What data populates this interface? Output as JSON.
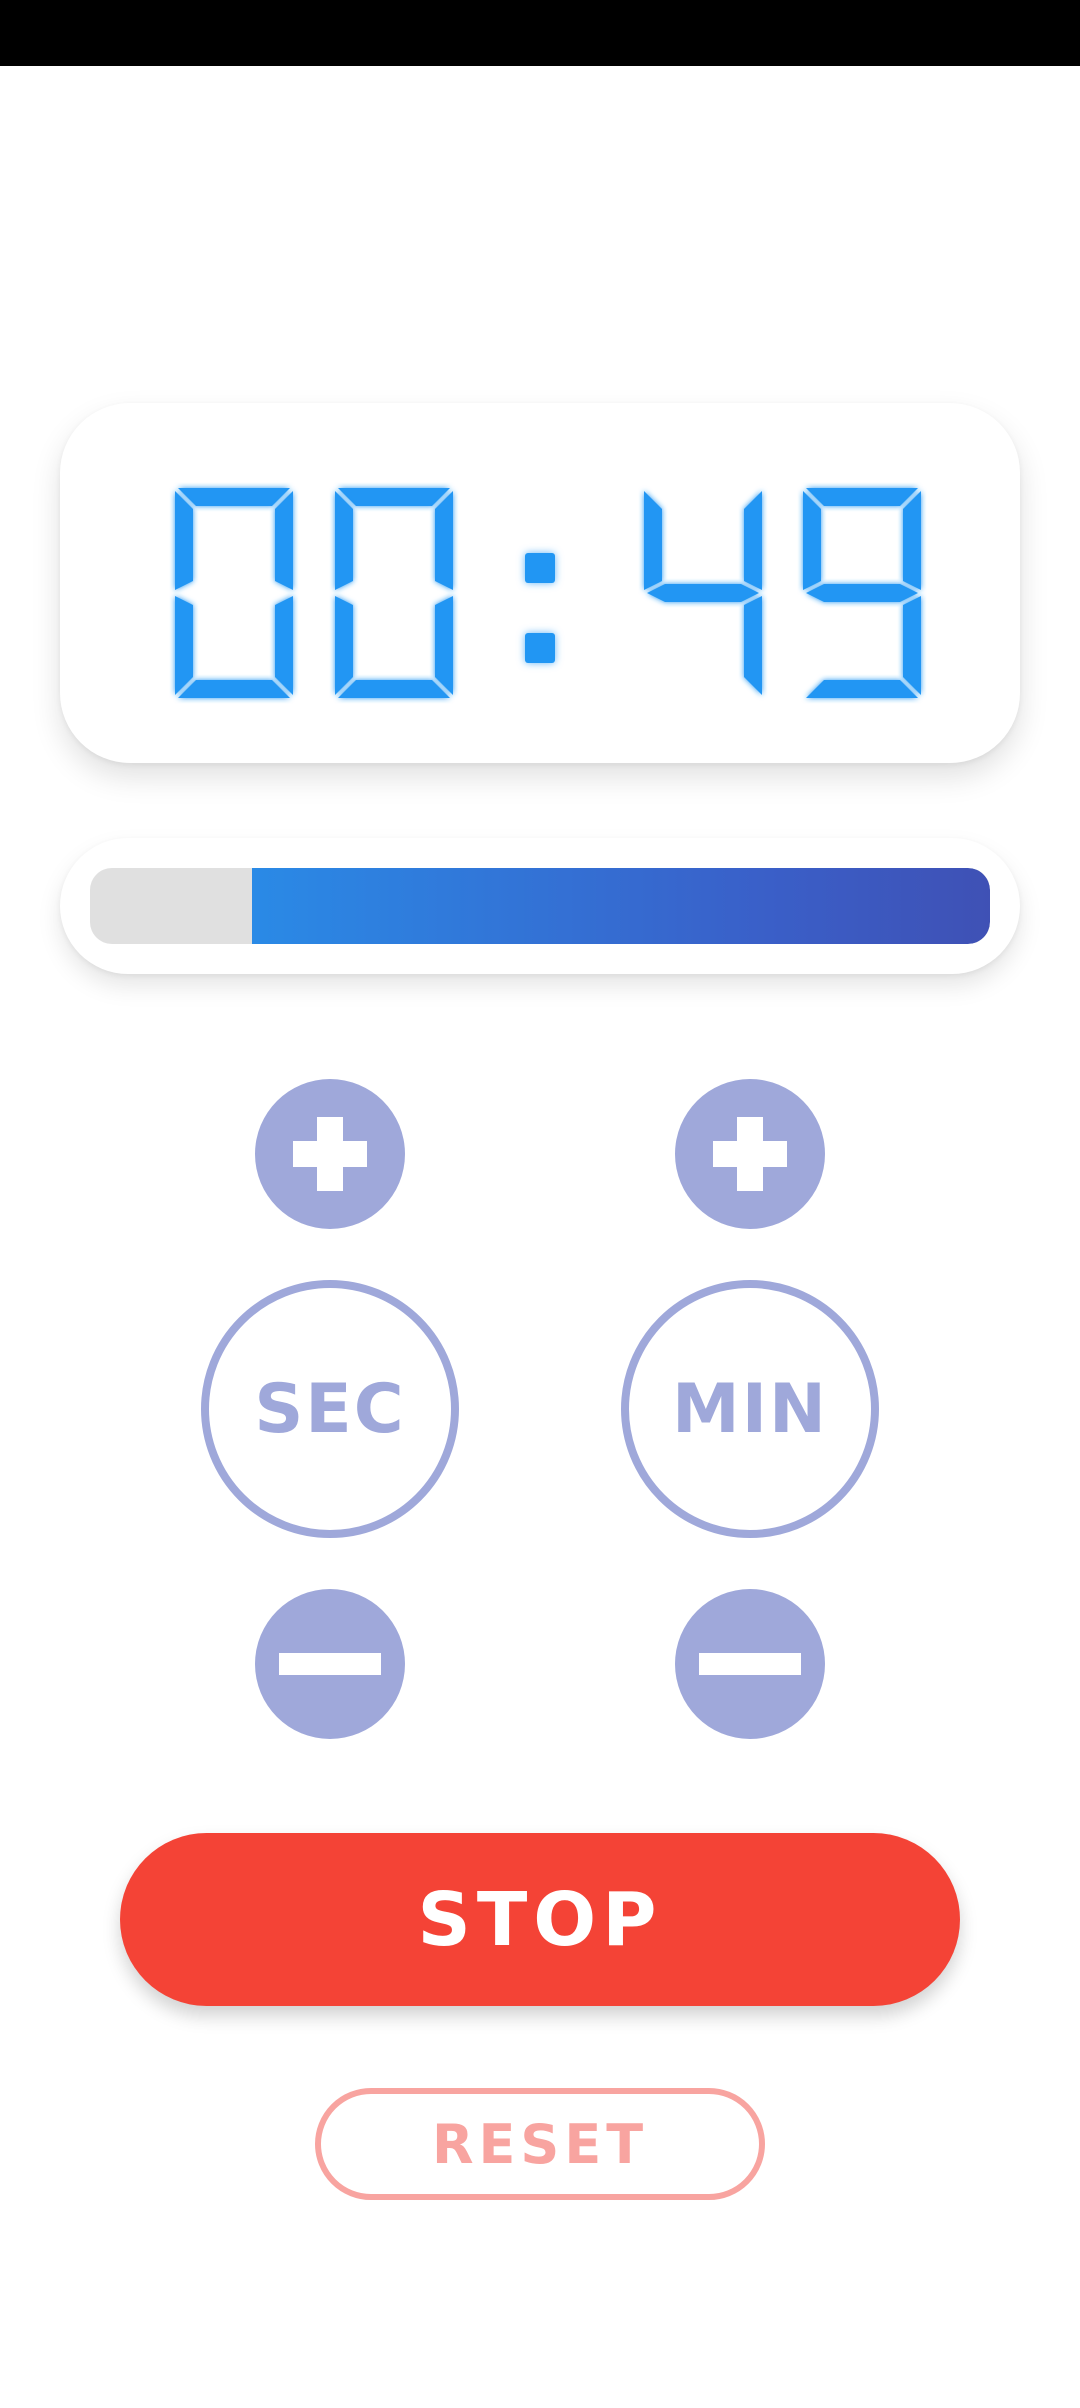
{
  "timer": {
    "minutes": "00",
    "seconds": "49",
    "separator": ":",
    "digit_color": "#2196f3"
  },
  "progress": {
    "fraction_remaining": 0.82,
    "track_color": "#e0e0e0",
    "fill_color": "#3f51b5"
  },
  "controls": {
    "seconds_label": "SEC",
    "minutes_label": "MIN",
    "increment_icon": "plus-icon",
    "decrement_icon": "minus-icon",
    "accent_color": "#9fa8da"
  },
  "actions": {
    "stop_label": "STOP",
    "reset_label": "RESET",
    "stop_color": "#f44336",
    "reset_color": "#f8a4a0"
  }
}
